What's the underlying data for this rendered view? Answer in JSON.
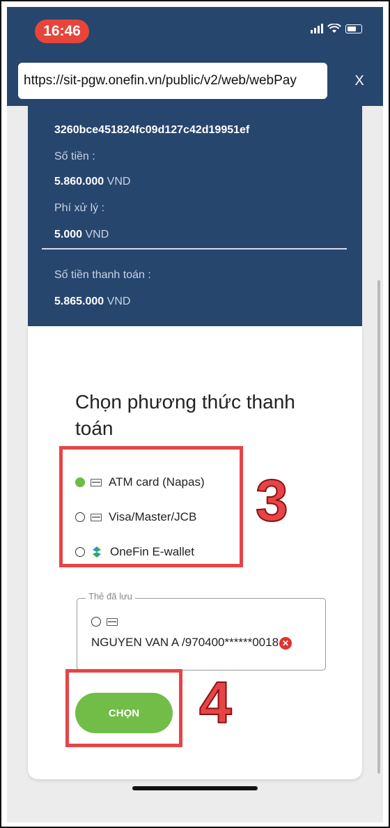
{
  "status_bar": {
    "time": "16:46"
  },
  "browser": {
    "url": "https://sit-pgw.onefin.vn/public/v2/web/webPay",
    "close_label": "X"
  },
  "summary": {
    "order_id": "3260bce451824fc09d127c42d19951ef",
    "amount_label": "Số tiền :",
    "amount_value": "5.860.000",
    "amount_currency": "VND",
    "fee_label": "Phí xử lý :",
    "fee_value": "5.000",
    "fee_currency": "VND",
    "total_label": "Số tiền thanh toán :",
    "total_value": "5.865.000",
    "total_currency": "VND"
  },
  "payment": {
    "title": "Chọn phương thức thanh toán",
    "options": [
      {
        "label": "ATM card (Napas)",
        "selected": true,
        "icon": "atm-card-icon"
      },
      {
        "label": "Visa/Master/JCB",
        "selected": false,
        "icon": "credit-card-icon"
      },
      {
        "label": "OneFin E-wallet",
        "selected": false,
        "icon": "onefin-logo-icon"
      }
    ]
  },
  "saved_cards": {
    "legend": "Thẻ đã lưu",
    "card_text": "NGUYEN VAN A /970400******0018"
  },
  "submit": {
    "label": "CHỌN"
  },
  "annotations": {
    "step3": "3",
    "step4": "4"
  },
  "colors": {
    "header_blue": "#26466e",
    "accent_green": "#71bd48",
    "annotation_red": "#e74447"
  }
}
